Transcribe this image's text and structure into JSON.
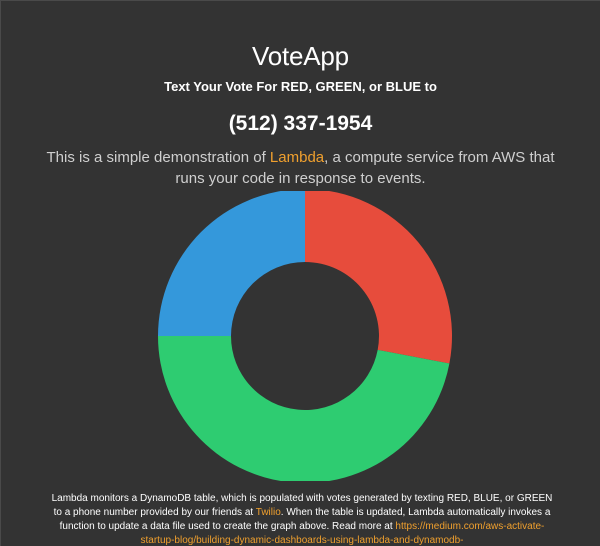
{
  "header": {
    "title": "VoteApp",
    "instruction": "Text Your Vote For RED, GREEN, or BLUE to",
    "phone": "(512) 337-1954",
    "description_pre": "This is a simple demonstration of ",
    "description_link": "Lambda",
    "description_post": ", a compute service from AWS that runs your code in response to events."
  },
  "footer": {
    "text_pre": "Lambda monitors a DynamoDB table, which is populated with votes generated by texting RED, BLUE, or GREEN to a phone number provided by our friends at ",
    "link_twilio": "Twilio",
    "text_post": ". When the table is updated, Lambda automatically invokes a function to update a data file used to create the graph above. Read more at ",
    "link_url": "https://medium.com/aws-activate-startup-blog/building-dynamic-dashboards-using-lambda-and-dynamodb-"
  },
  "colors": {
    "background": "#333333",
    "link": "#f0a02e",
    "red": "#e74c3c",
    "green": "#2ecc71",
    "blue": "#3498db"
  },
  "chart_data": {
    "type": "pie",
    "variant": "donut",
    "categories": [
      "RED",
      "GREEN",
      "BLUE"
    ],
    "values": [
      28,
      47,
      25
    ],
    "colors": [
      "#e74c3c",
      "#2ecc71",
      "#3498db"
    ]
  }
}
